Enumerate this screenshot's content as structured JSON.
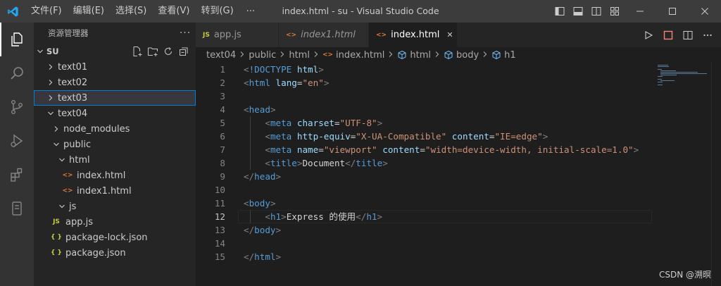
{
  "titlebar": {
    "menu": [
      "文件(F)",
      "编辑(E)",
      "选择(S)",
      "查看(V)",
      "转到(G)"
    ],
    "more": "···",
    "title": "index.html - su - Visual Studio Code"
  },
  "sidebar": {
    "header": "资源管理器",
    "more": "···",
    "root_folder": "SU",
    "tree": [
      {
        "label": "text01",
        "kind": "folder",
        "depth": 0,
        "open": false
      },
      {
        "label": "text02",
        "kind": "folder",
        "depth": 0,
        "open": false
      },
      {
        "label": "text03",
        "kind": "folder",
        "depth": 0,
        "open": false,
        "selected": true
      },
      {
        "label": "text04",
        "kind": "folder",
        "depth": 0,
        "open": true
      },
      {
        "label": "node_modules",
        "kind": "folder",
        "depth": 1,
        "open": false
      },
      {
        "label": "public",
        "kind": "folder",
        "depth": 1,
        "open": true
      },
      {
        "label": "html",
        "kind": "folder",
        "depth": 2,
        "open": true
      },
      {
        "label": "index.html",
        "kind": "html",
        "depth": 3
      },
      {
        "label": "index1.html",
        "kind": "html",
        "depth": 3
      },
      {
        "label": "js",
        "kind": "folder",
        "depth": 2,
        "open": true
      },
      {
        "label": "app.js",
        "kind": "js",
        "depth": 1
      },
      {
        "label": "package-lock.json",
        "kind": "json",
        "depth": 1
      },
      {
        "label": "package.json",
        "kind": "json",
        "depth": 1
      }
    ]
  },
  "tabs": [
    {
      "label": "app.js",
      "kind": "js",
      "active": false,
      "italic": false
    },
    {
      "label": "index1.html",
      "kind": "html",
      "active": false,
      "italic": true
    },
    {
      "label": "index.html",
      "kind": "html",
      "active": true,
      "italic": false
    }
  ],
  "breadcrumbs": [
    "text04",
    "public",
    "html",
    "index.html",
    "html",
    "body",
    "h1"
  ],
  "editor": {
    "current_line": 12,
    "lines": [
      [
        [
          "br",
          "<"
        ],
        [
          "tag",
          "!DOCTYPE"
        ],
        [
          "text",
          " "
        ],
        [
          "attr",
          "html"
        ],
        [
          "br",
          ">"
        ]
      ],
      [
        [
          "br",
          "<"
        ],
        [
          "tag",
          "html"
        ],
        [
          "text",
          " "
        ],
        [
          "attr",
          "lang"
        ],
        [
          "text",
          "="
        ],
        [
          "val",
          "\"en\""
        ],
        [
          "br",
          ">"
        ]
      ],
      [],
      [
        [
          "br",
          "<"
        ],
        [
          "tag",
          "head"
        ],
        [
          "br",
          ">"
        ]
      ],
      [
        [
          "text",
          "    "
        ],
        [
          "br",
          "<"
        ],
        [
          "tag",
          "meta"
        ],
        [
          "text",
          " "
        ],
        [
          "attr",
          "charset"
        ],
        [
          "text",
          "="
        ],
        [
          "val",
          "\"UTF-8\""
        ],
        [
          "br",
          ">"
        ]
      ],
      [
        [
          "text",
          "    "
        ],
        [
          "br",
          "<"
        ],
        [
          "tag",
          "meta"
        ],
        [
          "text",
          " "
        ],
        [
          "attr",
          "http-equiv"
        ],
        [
          "text",
          "="
        ],
        [
          "val",
          "\"X-UA-Compatible\""
        ],
        [
          "text",
          " "
        ],
        [
          "attr",
          "content"
        ],
        [
          "text",
          "="
        ],
        [
          "val",
          "\"IE=edge\""
        ],
        [
          "br",
          ">"
        ]
      ],
      [
        [
          "text",
          "    "
        ],
        [
          "br",
          "<"
        ],
        [
          "tag",
          "meta"
        ],
        [
          "text",
          " "
        ],
        [
          "attr",
          "name"
        ],
        [
          "text",
          "="
        ],
        [
          "val",
          "\"viewport\""
        ],
        [
          "text",
          " "
        ],
        [
          "attr",
          "content"
        ],
        [
          "text",
          "="
        ],
        [
          "val",
          "\"width=device-width, initial-scale=1.0\""
        ],
        [
          "br",
          ">"
        ]
      ],
      [
        [
          "text",
          "    "
        ],
        [
          "br",
          "<"
        ],
        [
          "tag",
          "title"
        ],
        [
          "br",
          ">"
        ],
        [
          "text",
          "Document"
        ],
        [
          "br",
          "</"
        ],
        [
          "tag",
          "title"
        ],
        [
          "br",
          ">"
        ]
      ],
      [
        [
          "br",
          "</"
        ],
        [
          "tag",
          "head"
        ],
        [
          "br",
          ">"
        ]
      ],
      [],
      [
        [
          "br",
          "<"
        ],
        [
          "tag",
          "body"
        ],
        [
          "br",
          ">"
        ]
      ],
      [
        [
          "text",
          "    "
        ],
        [
          "br",
          "<"
        ],
        [
          "tag",
          "h1"
        ],
        [
          "br",
          ">"
        ],
        [
          "text",
          "Express 的使用"
        ],
        [
          "br",
          "</"
        ],
        [
          "tag",
          "h1"
        ],
        [
          "br",
          ">"
        ]
      ],
      [
        [
          "br",
          "</"
        ],
        [
          "tag",
          "body"
        ],
        [
          "br",
          ">"
        ]
      ],
      [],
      [
        [
          "br",
          "</"
        ],
        [
          "tag",
          "html"
        ],
        [
          "br",
          ">"
        ]
      ]
    ]
  },
  "watermark": "CSDN @溯暝",
  "colors": {
    "accent": "#007acc",
    "selection_border": "#007fd4",
    "activity_bar": "#333333",
    "sidebar": "#252526",
    "editor": "#1e1e1e"
  }
}
